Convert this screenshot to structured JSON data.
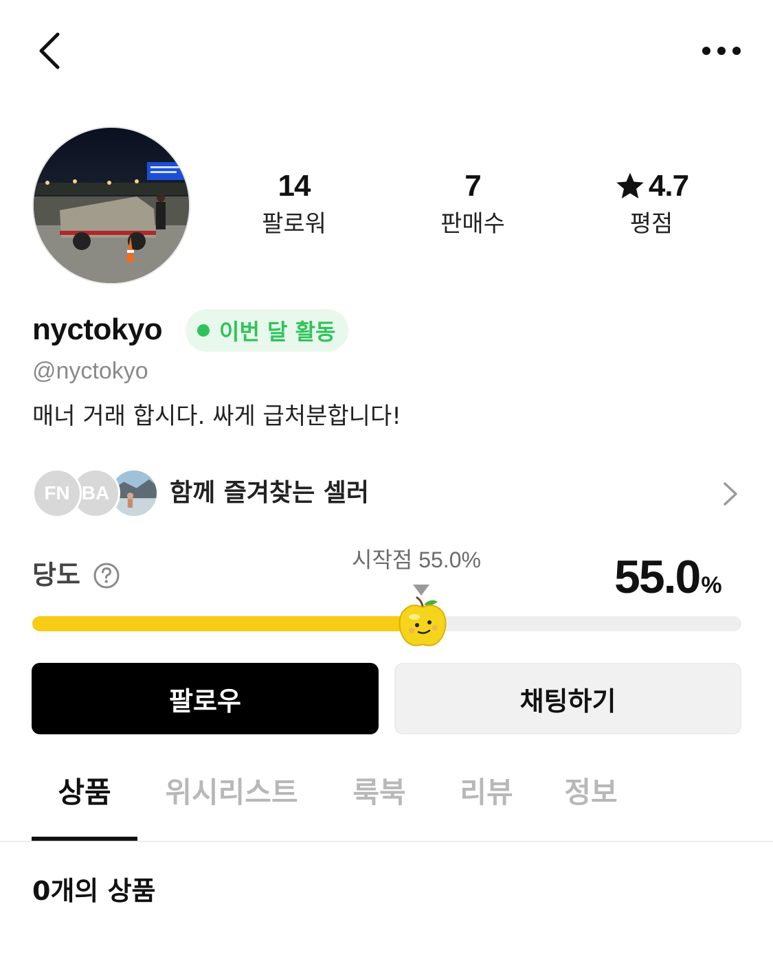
{
  "profile": {
    "name": "nyctokyo",
    "handle": "@nyctokyo",
    "bio": "매너 거래 합시다. 싸게 급처분합니다!",
    "badge": "이번 달 활동"
  },
  "stats": [
    {
      "value": "14",
      "label": "팔로워"
    },
    {
      "value": "7",
      "label": "판매수"
    },
    {
      "value": "4.7",
      "label": "평점",
      "icon": "star-icon"
    }
  ],
  "sellers": {
    "label": "함께 즐겨찾는 셀러",
    "avatars": [
      {
        "initials": "FN"
      },
      {
        "initials": "BA"
      },
      {
        "initials": ""
      }
    ]
  },
  "sugar": {
    "label": "당도",
    "start_label": "시작점 55.0%",
    "value": "55.0",
    "unit": "%",
    "level_percent": 55.0
  },
  "buttons": {
    "follow": "팔로우",
    "chat": "채팅하기"
  },
  "tabs": [
    {
      "label": "상품",
      "active": true
    },
    {
      "label": "위시리스트",
      "active": false
    },
    {
      "label": "룩북",
      "active": false
    },
    {
      "label": "리뷰",
      "active": false
    },
    {
      "label": "정보",
      "active": false
    }
  ],
  "products": {
    "count_label": "0개의 상품"
  },
  "colors": {
    "badge_green": "#2ec35a",
    "badge_bg": "#e9f8ec",
    "sugar_fill": "#f6cc16",
    "follow_bg": "#000000",
    "chat_bg": "#f1f1f1"
  }
}
